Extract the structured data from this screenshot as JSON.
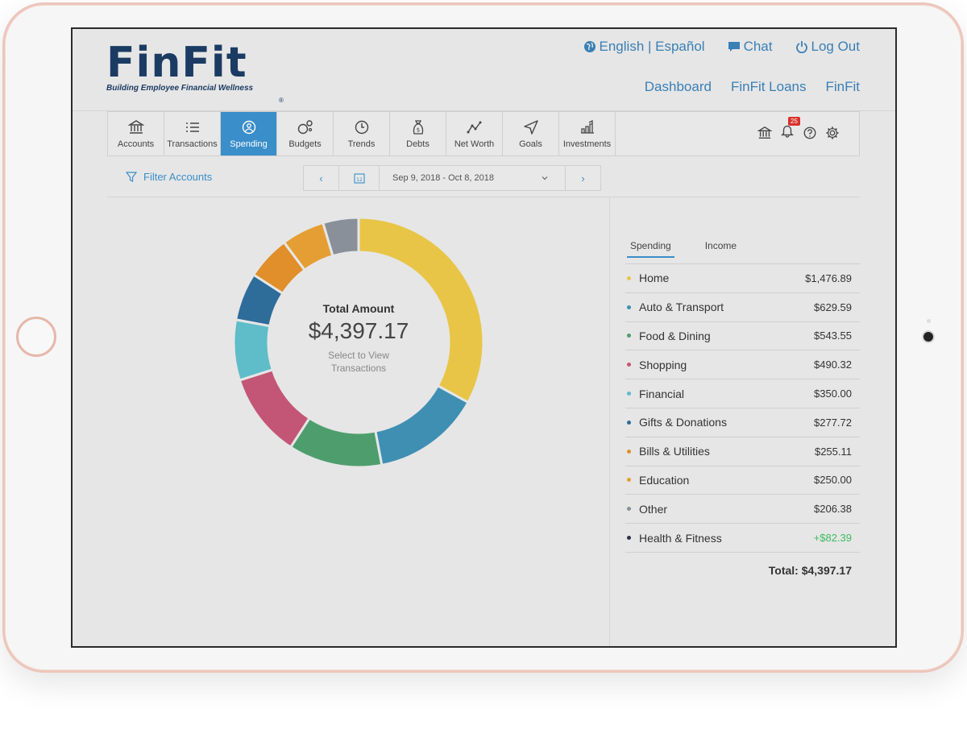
{
  "logo": {
    "word": "FinFit",
    "reg": "®",
    "tagline": "Building Employee Financial Wellness"
  },
  "top_links": {
    "language": "English | Español",
    "chat": "Chat",
    "logout": "Log Out"
  },
  "nav_links": {
    "dashboard": "Dashboard",
    "loans": "FinFit Loans",
    "finfit": "FinFit"
  },
  "tabs": [
    {
      "label": "Accounts",
      "icon": "bank-icon"
    },
    {
      "label": "Transactions",
      "icon": "list-icon"
    },
    {
      "label": "Spending",
      "icon": "spending-icon",
      "active": true
    },
    {
      "label": "Budgets",
      "icon": "budgets-icon"
    },
    {
      "label": "Trends",
      "icon": "clock-icon"
    },
    {
      "label": "Debts",
      "icon": "money-bag-icon"
    },
    {
      "label": "Net Worth",
      "icon": "line-chart-icon"
    },
    {
      "label": "Goals",
      "icon": "navigation-icon"
    },
    {
      "label": "Investments",
      "icon": "investments-icon"
    }
  ],
  "tools": {
    "notification_count": "25"
  },
  "filter": {
    "label": "Filter Accounts"
  },
  "date_range": {
    "prev": "‹",
    "next": "›",
    "calendar": "12",
    "value": "Sep 9, 2018 - Oct 8, 2018"
  },
  "center": {
    "label": "Total Amount",
    "value": "$4,397.17",
    "sub": "Select to View Transactions"
  },
  "subtabs": {
    "spending": "Spending",
    "income": "Income"
  },
  "categories": [
    {
      "name": "Home",
      "amount": "$1,476.89",
      "color": "#e8c547"
    },
    {
      "name": "Auto & Transport",
      "amount": "$629.59",
      "color": "#3f8fb3"
    },
    {
      "name": "Food & Dining",
      "amount": "$543.55",
      "color": "#4e9e6d"
    },
    {
      "name": "Shopping",
      "amount": "$490.32",
      "color": "#c35676"
    },
    {
      "name": "Financial",
      "amount": "$350.00",
      "color": "#5fbcc9"
    },
    {
      "name": "Gifts & Donations",
      "amount": "$277.72",
      "color": "#2e6c99"
    },
    {
      "name": "Bills & Utilities",
      "amount": "$255.11",
      "color": "#e08f2b"
    },
    {
      "name": "Education",
      "amount": "$250.00",
      "color": "#e59e34"
    },
    {
      "name": "Other",
      "amount": "$206.38",
      "color": "#8a9099"
    },
    {
      "name": "Health & Fitness",
      "amount": "+$82.39",
      "color": "#2f2f4f",
      "positive": true
    }
  ],
  "total": "Total: $4,397.17",
  "chart_data": {
    "type": "pie",
    "categories": [
      "Home",
      "Auto & Transport",
      "Food & Dining",
      "Shopping",
      "Financial",
      "Gifts & Donations",
      "Bills & Utilities",
      "Education",
      "Other"
    ],
    "values": [
      1476.89,
      629.59,
      543.55,
      490.32,
      350.0,
      277.72,
      255.11,
      250.0,
      206.38
    ],
    "colors": [
      "#e8c547",
      "#3f8fb3",
      "#4e9e6d",
      "#c35676",
      "#5fbcc9",
      "#2e6c99",
      "#e08f2b",
      "#e59e34",
      "#8a9099"
    ]
  }
}
